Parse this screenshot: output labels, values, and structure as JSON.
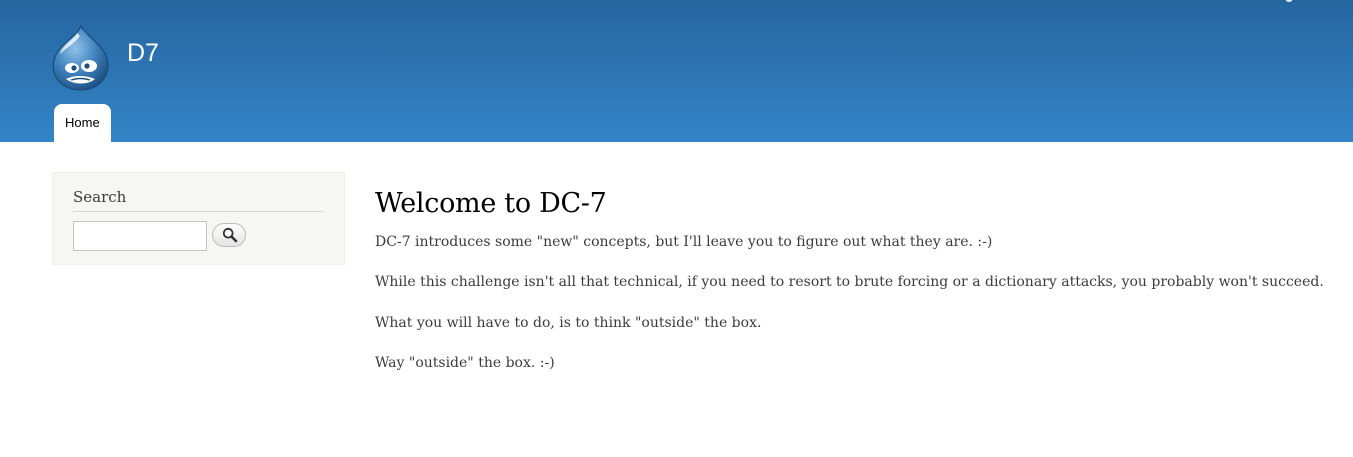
{
  "header": {
    "site_name": "D7"
  },
  "main_menu": {
    "items": [
      {
        "label": "Home",
        "active": true
      }
    ]
  },
  "sidebar": {
    "search_block": {
      "title": "Search",
      "input_value": "",
      "button_icon": "search-icon"
    }
  },
  "content": {
    "title": "Welcome to DC-7",
    "paragraphs": [
      "DC-7 introduces some \"new\" concepts, but I'll leave you to figure out what they are.  :-)",
      "While this challenge isn't all that technical, if you need to resort to brute forcing or a dictionary attacks, you probably won't succeed.",
      "What you will have to do, is to think \"outside\" the box.",
      "Way \"outside\" the box.  :-)"
    ]
  },
  "colors": {
    "header_top": "#2466a0",
    "header_bottom": "#3385c7",
    "sidebar_bg": "#f6f6f2",
    "text": "#3b3b3b"
  }
}
